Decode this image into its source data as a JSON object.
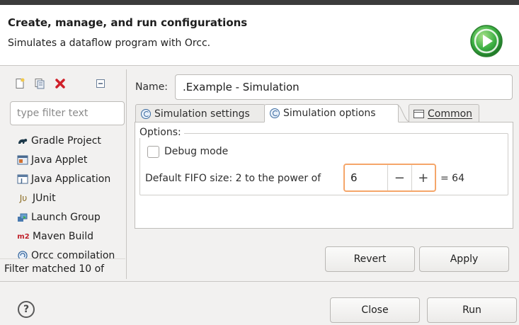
{
  "header": {
    "title": "Create, manage, and run configurations",
    "description": "Simulates a dataflow program with Orcc.",
    "icon": "run-icon"
  },
  "toolbar": {
    "icons": [
      "new-configuration-icon",
      "duplicate-icon",
      "delete-icon",
      "collapse-all-icon"
    ]
  },
  "filter": {
    "placeholder": "type filter text",
    "status": "Filter matched 10 of"
  },
  "tree": {
    "items": [
      {
        "label": "Gradle Project",
        "icon": "gradle-icon"
      },
      {
        "label": "Java Applet",
        "icon": "java-applet-icon"
      },
      {
        "label": "Java Application",
        "icon": "java-application-icon"
      },
      {
        "label": "JUnit",
        "icon": "junit-icon",
        "icon_text": "Jυ"
      },
      {
        "label": "Launch Group",
        "icon": "launch-group-icon"
      },
      {
        "label": "Maven Build",
        "icon": "maven-icon",
        "icon_text": "m2"
      },
      {
        "label": "Orcc compilation",
        "icon": "orcc-icon"
      }
    ]
  },
  "config": {
    "name_label": "Name:",
    "name_value": ".Example - Simulation",
    "tabs": [
      {
        "label": "Simulation settings",
        "active": false
      },
      {
        "label": "Simulation options",
        "active": true
      },
      {
        "label": "Common",
        "mnemonic": "C",
        "active": false
      }
    ],
    "options": {
      "group_label": "Options:",
      "debug_mode_label": "Debug mode",
      "debug_mode_checked": false,
      "fifo_label": "Default FIFO size: 2 to the power of",
      "fifo_value": "6",
      "fifo_result": "= 64",
      "decrement_label": "−",
      "increment_label": "+"
    }
  },
  "buttons": {
    "revert": "Revert",
    "apply": "Apply",
    "close": "Close",
    "run": "Run",
    "help": "?"
  },
  "colors": {
    "accent_focus": "#f5a66a",
    "run_icon_green": "#3cb043",
    "delete_red": "#d0202a"
  }
}
